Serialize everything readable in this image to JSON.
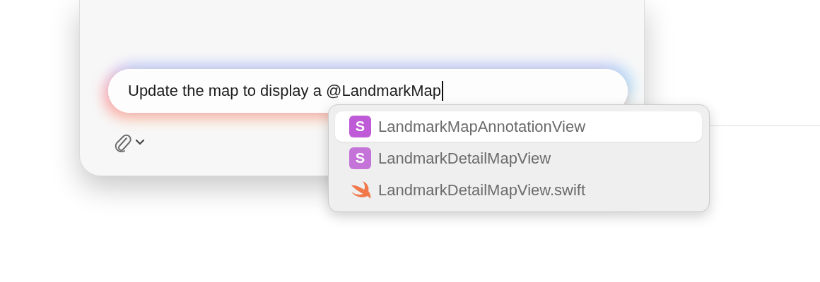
{
  "composer": {
    "value": "Update the map to display a @LandmarkMap"
  },
  "suggestions": [
    {
      "kind": "struct",
      "badge": "S",
      "label": "LandmarkMapAnnotationView",
      "selected": true
    },
    {
      "kind": "struct",
      "badge": "S",
      "label": "LandmarkDetailMapView",
      "selected": false
    },
    {
      "kind": "file",
      "label": "LandmarkDetailMapView.swift",
      "selected": false
    }
  ]
}
